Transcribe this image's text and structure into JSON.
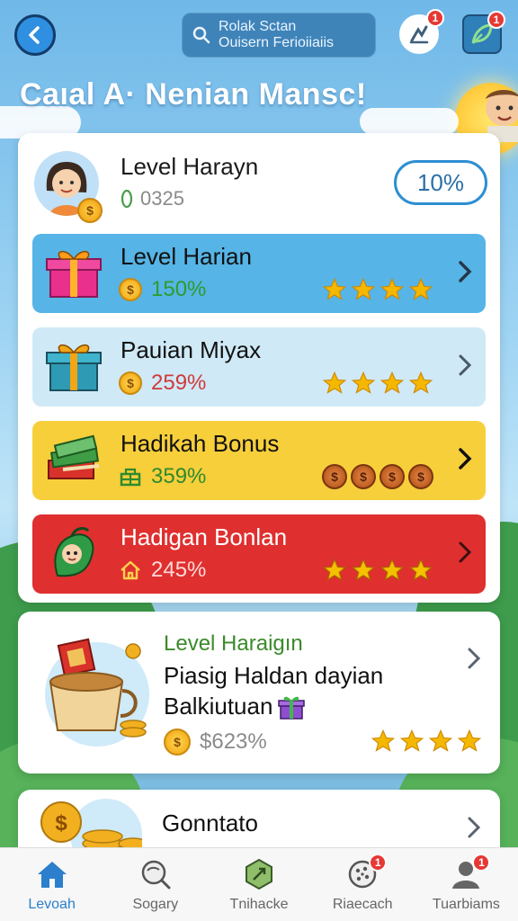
{
  "header": {
    "back_icon": "chevron-left-icon",
    "search": {
      "line1": "Rolak Sctan",
      "line2": "Ouisern Ferioiiaiis",
      "icon": "search-icon"
    },
    "notification_badge": "1",
    "profile_badge": "1",
    "title": "Caıal A· Nenian Mansc!"
  },
  "profile": {
    "name": "Level Harayn",
    "score": "0325",
    "percent": "10%"
  },
  "rows": [
    {
      "title": "Level Harian",
      "value": "150%",
      "stars": 4,
      "bg": "#56b4e6",
      "value_color": "#2e9b2e"
    },
    {
      "title": "Pauian Miyax",
      "value": "259%",
      "stars": 4,
      "bg": "#cfe9f6",
      "value_color": "#d03a3a"
    },
    {
      "title": "Hadikah Bonus",
      "value": "359%",
      "stars": 4,
      "bg": "#f7cf3b",
      "value_color": "#2e8a2e"
    },
    {
      "title": "Hadigan Bonlan",
      "value": "245%",
      "stars": 4,
      "bg": "#df2f2f",
      "value_color": "#ffd9d9"
    }
  ],
  "card2": {
    "subtitle": "Level Haraigın",
    "title_line1": "Piasig Haldan dayian",
    "title_line2": "Balkiutuan",
    "value": "$623%",
    "stars": 4
  },
  "card3": {
    "title": "Gonntato"
  },
  "bottom_nav": [
    {
      "label": "Levoah",
      "icon": "home-icon",
      "active": true,
      "badge": ""
    },
    {
      "label": "Sogary",
      "icon": "magnifier-icon",
      "active": false,
      "badge": ""
    },
    {
      "label": "Tnihacke",
      "icon": "hexagon-tool-icon",
      "active": false,
      "badge": ""
    },
    {
      "label": "Riaecach",
      "icon": "cookie-icon",
      "active": false,
      "badge": "1"
    },
    {
      "label": "Tuarbiams",
      "icon": "user-icon",
      "active": false,
      "badge": "1"
    }
  ],
  "colors": {
    "accent": "#2d8fd2",
    "star": "#f5b800"
  }
}
